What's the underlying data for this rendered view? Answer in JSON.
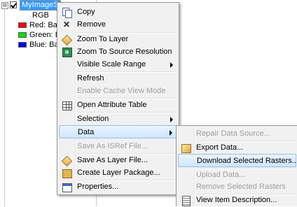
{
  "toc": {
    "layer_name": "MyImageServer",
    "layer_checked": true,
    "expander_symbol": "⊟",
    "rgb_label": "RGB",
    "bands": [
      {
        "label": "Red:",
        "value": "Ba",
        "color": "#ff0000"
      },
      {
        "label": "Green:",
        "value": "Ba",
        "color": "#00dd00"
      },
      {
        "label": "Blue:",
        "value": "Ba",
        "color": "#0000ff"
      }
    ]
  },
  "context_menu": {
    "copy": "Copy",
    "remove": "Remove",
    "zoom_to_layer": "Zoom To Layer",
    "zoom_to_source_resolution": "Zoom To Source Resolution",
    "visible_scale_range": "Visible Scale Range",
    "refresh": "Refresh",
    "enable_cache_view_mode": "Enable Cache View Mode",
    "open_attribute_table": "Open Attribute Table",
    "selection": "Selection",
    "data": "Data",
    "save_as_isref_file": "Save As ISRef File...",
    "save_as_layer_file": "Save As Layer File...",
    "create_layer_package": "Create Layer Package...",
    "properties": "Properties..."
  },
  "data_submenu": {
    "repair_data_source": "Repair Data Source...",
    "export_data": "Export Data...",
    "download_selected_rasters": "Download Selected Rasters...",
    "upload_data": "Upload Data...",
    "remove_selected_rasters": "Remove Selected Rasters",
    "view_item_description": "View Item Description..."
  },
  "colors": {
    "selection": "#3399ff",
    "hover_border": "#97c0ea",
    "disabled_text": "#a0a0a0"
  }
}
